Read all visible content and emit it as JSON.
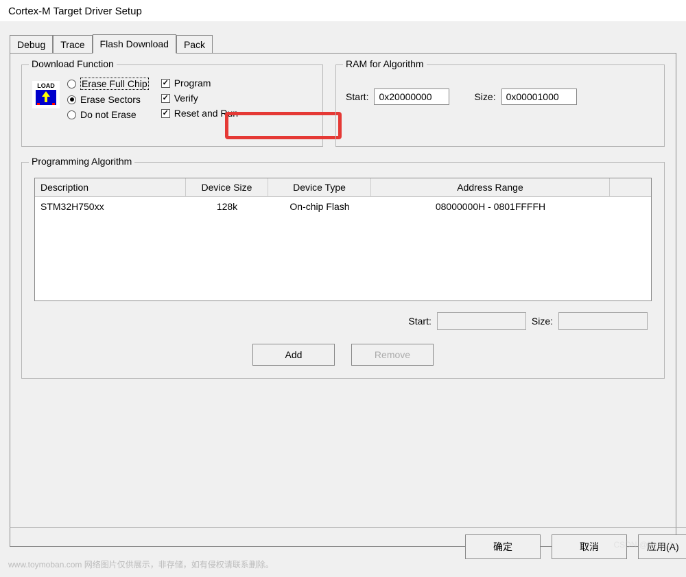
{
  "window": {
    "title": "Cortex-M Target Driver Setup"
  },
  "tabs": {
    "items": [
      "Debug",
      "Trace",
      "Flash Download",
      "Pack"
    ],
    "active_index": 2
  },
  "download_function": {
    "title": "Download Function",
    "erase_options": {
      "full_chip": "Erase Full Chip",
      "sectors": "Erase Sectors",
      "do_not": "Do not Erase",
      "selected": "sectors"
    },
    "checkboxes": {
      "program": {
        "label": "Program",
        "checked": true
      },
      "verify": {
        "label": "Verify",
        "checked": true
      },
      "reset_run": {
        "label": "Reset and Run",
        "checked": true
      }
    }
  },
  "ram_algorithm": {
    "title": "RAM for Algorithm",
    "start_label": "Start:",
    "start_value": "0x20000000",
    "size_label": "Size:",
    "size_value": "0x00001000"
  },
  "programming_algorithm": {
    "title": "Programming Algorithm",
    "columns": {
      "description": "Description",
      "device_size": "Device Size",
      "device_type": "Device Type",
      "address_range": "Address Range"
    },
    "rows": [
      {
        "description": "STM32H750xx",
        "device_size": "128k",
        "device_type": "On-chip Flash",
        "address_range": "08000000H - 0801FFFFH"
      }
    ],
    "footer": {
      "start_label": "Start:",
      "start_value": "",
      "size_label": "Size:",
      "size_value": ""
    },
    "buttons": {
      "add": "Add",
      "remove": "Remove"
    }
  },
  "dialog_buttons": {
    "ok": "确定",
    "cancel": "取消",
    "apply": "应用(A)"
  },
  "watermark": {
    "left": "www.toymoban.com 网络图片仅供展示，非存储，如有侵权请联系删除。",
    "right": "CSDN @Kent Gu"
  }
}
